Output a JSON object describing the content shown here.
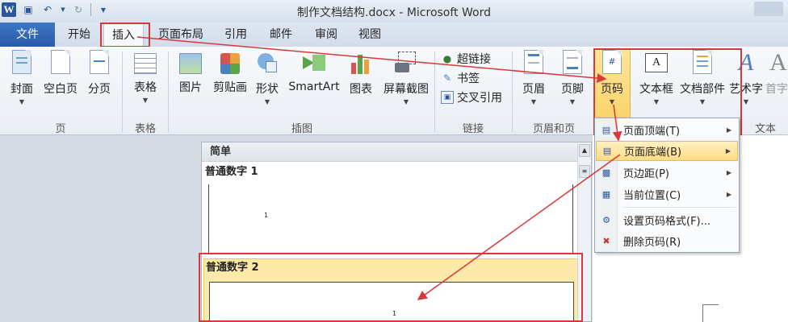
{
  "window": {
    "title": "制作文档结构.docx - Microsoft Word"
  },
  "qat": {
    "logo": "W"
  },
  "tabs": [
    {
      "label": "文件"
    },
    {
      "label": "开始"
    },
    {
      "label": "插入"
    },
    {
      "label": "页面布局"
    },
    {
      "label": "引用"
    },
    {
      "label": "邮件"
    },
    {
      "label": "审阅"
    },
    {
      "label": "视图"
    }
  ],
  "ribbon": {
    "groups": {
      "pages": "页",
      "tables": "表格",
      "illustrations": "插图",
      "links": "链接",
      "header_footer": "页眉和页",
      "text": "文本"
    },
    "buttons": {
      "cover": "封面",
      "blank": "空白页",
      "break": "分页",
      "table": "表格",
      "picture": "图片",
      "clipart": "剪贴画",
      "shapes": "形状",
      "smartart": "SmartArt",
      "chart": "图表",
      "screenshot": "屏幕截图",
      "hyperlink": "超链接",
      "bookmark": "书签",
      "crossref": "交叉引用",
      "header": "页眉",
      "footer": "页脚",
      "pagenum": "页码",
      "textbox": "文本框",
      "quickparts": "文档部件",
      "wordart": "艺术字",
      "dropcap": "首字"
    },
    "pagenum_icon_text": "#"
  },
  "gallery": {
    "header": "简单",
    "items": [
      {
        "label": "普通数字 1",
        "num": "1"
      },
      {
        "label": "普通数字 2",
        "num": "1"
      }
    ]
  },
  "menu": {
    "items": [
      {
        "label": "页面顶端(T)"
      },
      {
        "label": "页面底端(B)"
      },
      {
        "label": "页边距(P)"
      },
      {
        "label": "当前位置(C)"
      },
      {
        "label": "设置页码格式(F)..."
      },
      {
        "label": "删除页码(R)"
      }
    ]
  },
  "colors": {
    "accent": "#2b579a",
    "highlight_border": "#d9383a",
    "hover": "#fddc84"
  }
}
